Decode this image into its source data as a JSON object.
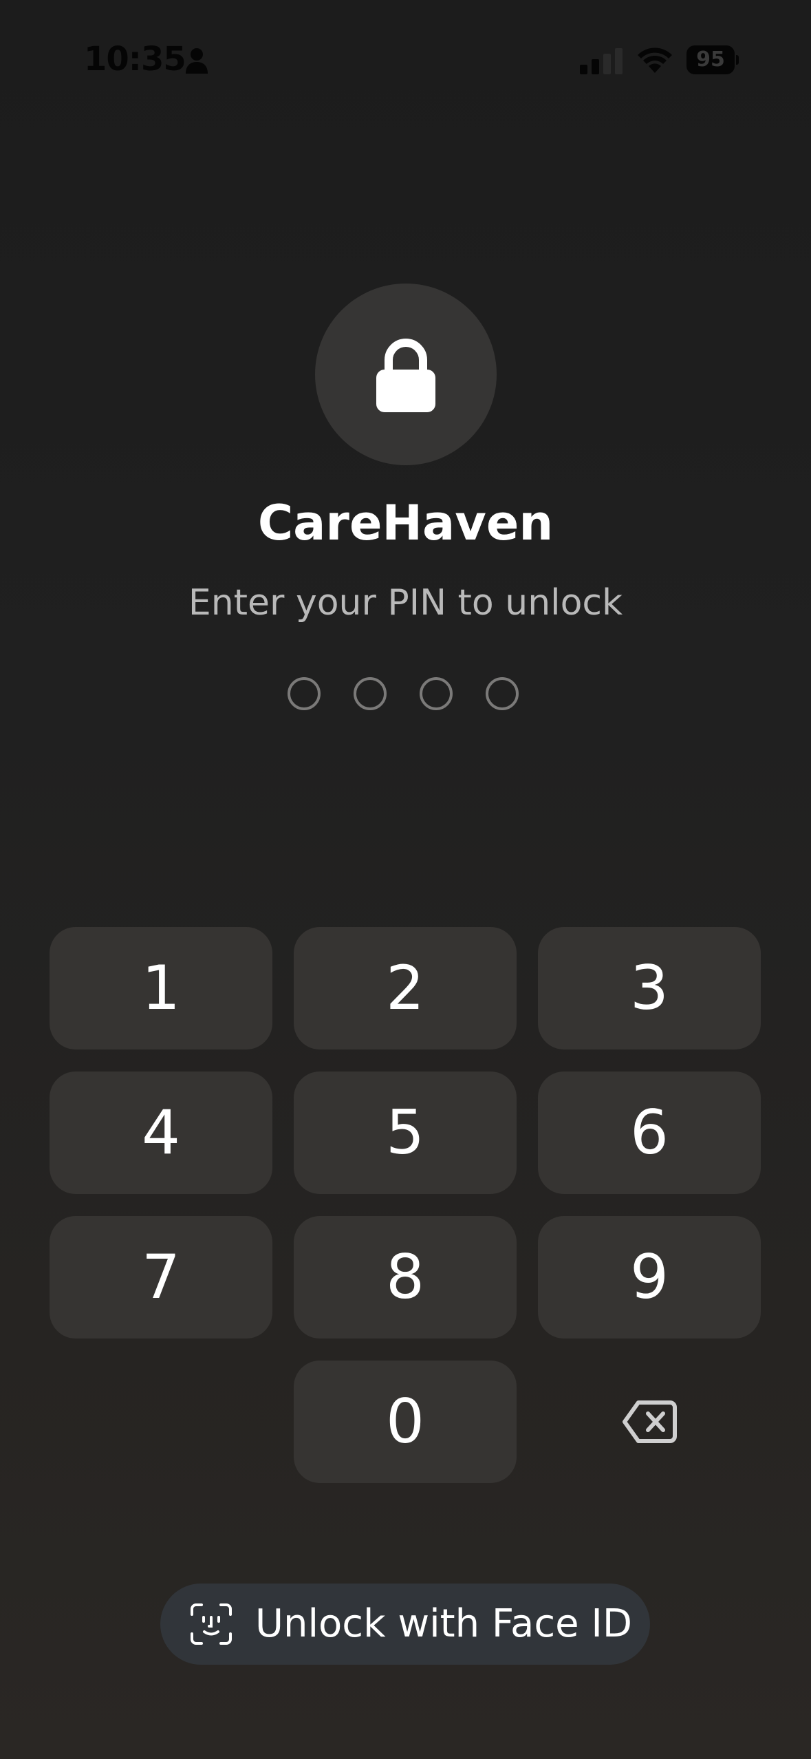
{
  "status_bar": {
    "time": "10:35",
    "battery_level": "95"
  },
  "lock": {
    "app_name": "CareHaven",
    "prompt": "Enter your PIN to unlock",
    "pin_length": 4,
    "pin_entered": 0
  },
  "keypad": {
    "keys": [
      "1",
      "2",
      "3",
      "4",
      "5",
      "6",
      "7",
      "8",
      "9",
      "0"
    ]
  },
  "face_id": {
    "label": "Unlock with Face ID"
  }
}
